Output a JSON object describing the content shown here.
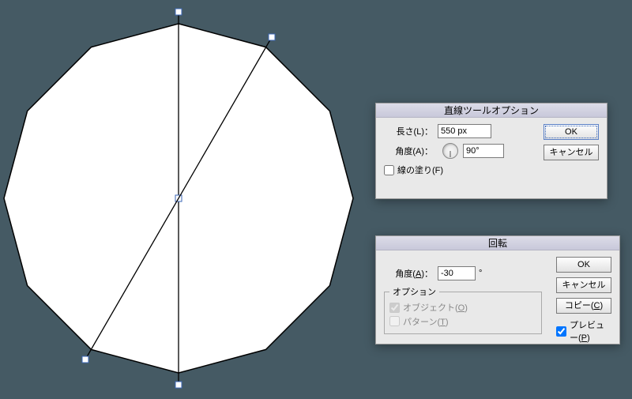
{
  "dialog_line": {
    "title": "直線ツールオプション",
    "length_label": "長さ(L)：",
    "length_value": "550 px",
    "angle_label": "角度(A)：",
    "angle_value": "90°",
    "fill_label": "線の塗り(F)",
    "ok": "OK",
    "cancel": "キャンセル"
  },
  "dialog_rotate": {
    "title": "回転",
    "angle_label_html": "角度(A)：",
    "angle_letter": "A",
    "angle_value": "-30",
    "angle_unit": "°",
    "options_legend": "オプション",
    "opt_object_label": "オブジェクト(O)",
    "opt_object_checked": true,
    "opt_pattern_label": "パターン(T)",
    "opt_pattern_checked": false,
    "preview_label": "プレビュー(P)",
    "preview_checked": true,
    "ok": "OK",
    "cancel": "キャンセル",
    "copy": "コピー(C)"
  }
}
